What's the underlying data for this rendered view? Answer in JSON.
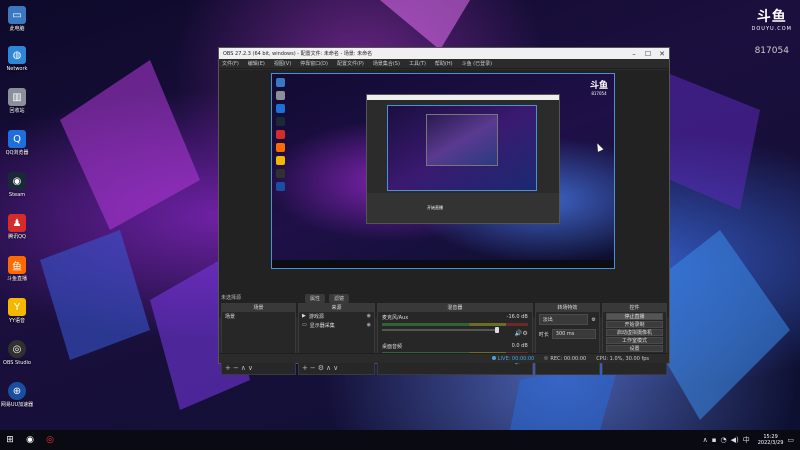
{
  "desktop": {
    "icons": [
      {
        "label": "此电脑",
        "icon": "computer-icon",
        "color": "#3a78c2",
        "glyph": "▭"
      },
      {
        "label": "Network",
        "icon": "network-icon",
        "color": "#2d86d6",
        "glyph": "◍"
      },
      {
        "label": "回收站",
        "icon": "recycle-bin-icon",
        "color": "#8a8f9a",
        "glyph": "▥"
      },
      {
        "label": "QQ浏览器",
        "icon": "qq-browser-icon",
        "color": "#1e6fd9",
        "glyph": "Q"
      },
      {
        "label": "Steam",
        "icon": "steam-icon",
        "color": "#1b2838",
        "glyph": "◉"
      },
      {
        "label": "腾讯QQ",
        "icon": "qq-penguin-icon",
        "color": "#d62b2b",
        "glyph": "♟"
      },
      {
        "label": "斗鱼直播",
        "icon": "douyu-icon",
        "color": "#ff6a00",
        "glyph": "鱼"
      },
      {
        "label": "YY语音",
        "icon": "yy-icon",
        "color": "#f5b800",
        "glyph": "Y"
      },
      {
        "label": "OBS Studio",
        "icon": "obs-icon",
        "color": "#303030",
        "glyph": "◎"
      },
      {
        "label": "网易UU加速器",
        "icon": "uu-accelerator-icon",
        "color": "#1a4fa0",
        "glyph": "⊕"
      }
    ]
  },
  "watermark": {
    "logo": "斗鱼",
    "url": "DOUYU.COM",
    "room": "817054"
  },
  "obs": {
    "title": "OBS 27.2.3 (64 bit, windows) - 配置文件: 未命名 - 场景: 未命名",
    "menu": [
      "文件(F)",
      "编辑(E)",
      "视图(V)",
      "停靠窗口(D)",
      "配置文件(P)",
      "场景集合(S)",
      "工具(T)",
      "帮助(H)",
      "斗鱼 (已登录)"
    ],
    "preview_label": "未选择源",
    "scene_tabs": [
      "属性",
      "滤镜"
    ],
    "docks": {
      "scenes": {
        "title": "场景",
        "items": [
          "场景"
        ]
      },
      "sources": {
        "title": "来源",
        "items": [
          {
            "name": "游戏源",
            "icon": "game-capture-icon"
          },
          {
            "name": "显示器采集",
            "icon": "monitor-icon"
          }
        ]
      },
      "mixer": {
        "title": "混音器",
        "channels": [
          {
            "name": "麦克风/Aux",
            "db": "-16.0 dB"
          },
          {
            "name": "桌面音频",
            "db": "0.0 dB"
          }
        ]
      },
      "transitions": {
        "title": "转场特效",
        "type": "淡出",
        "duration_label": "时长",
        "duration": "300 ms"
      },
      "controls": {
        "title": "控件",
        "buttons": [
          "停止直播",
          "开始录制",
          "启动虚拟摄像机",
          "工作室模式",
          "设置",
          "退出"
        ]
      }
    },
    "status": {
      "live_label": "LIVE:",
      "live_time": "00:00:00",
      "rec_label": "REC:",
      "rec_time": "00:00:00",
      "cpu": "CPU: 1.0%, 30.00 fps"
    },
    "inner_preview_text": "开始直播"
  },
  "taskbar": {
    "time": "15:29",
    "date": "2022/3/29",
    "apps": [
      "windows-start-icon",
      "steam-taskbar-icon",
      "obs-taskbar-icon"
    ]
  }
}
